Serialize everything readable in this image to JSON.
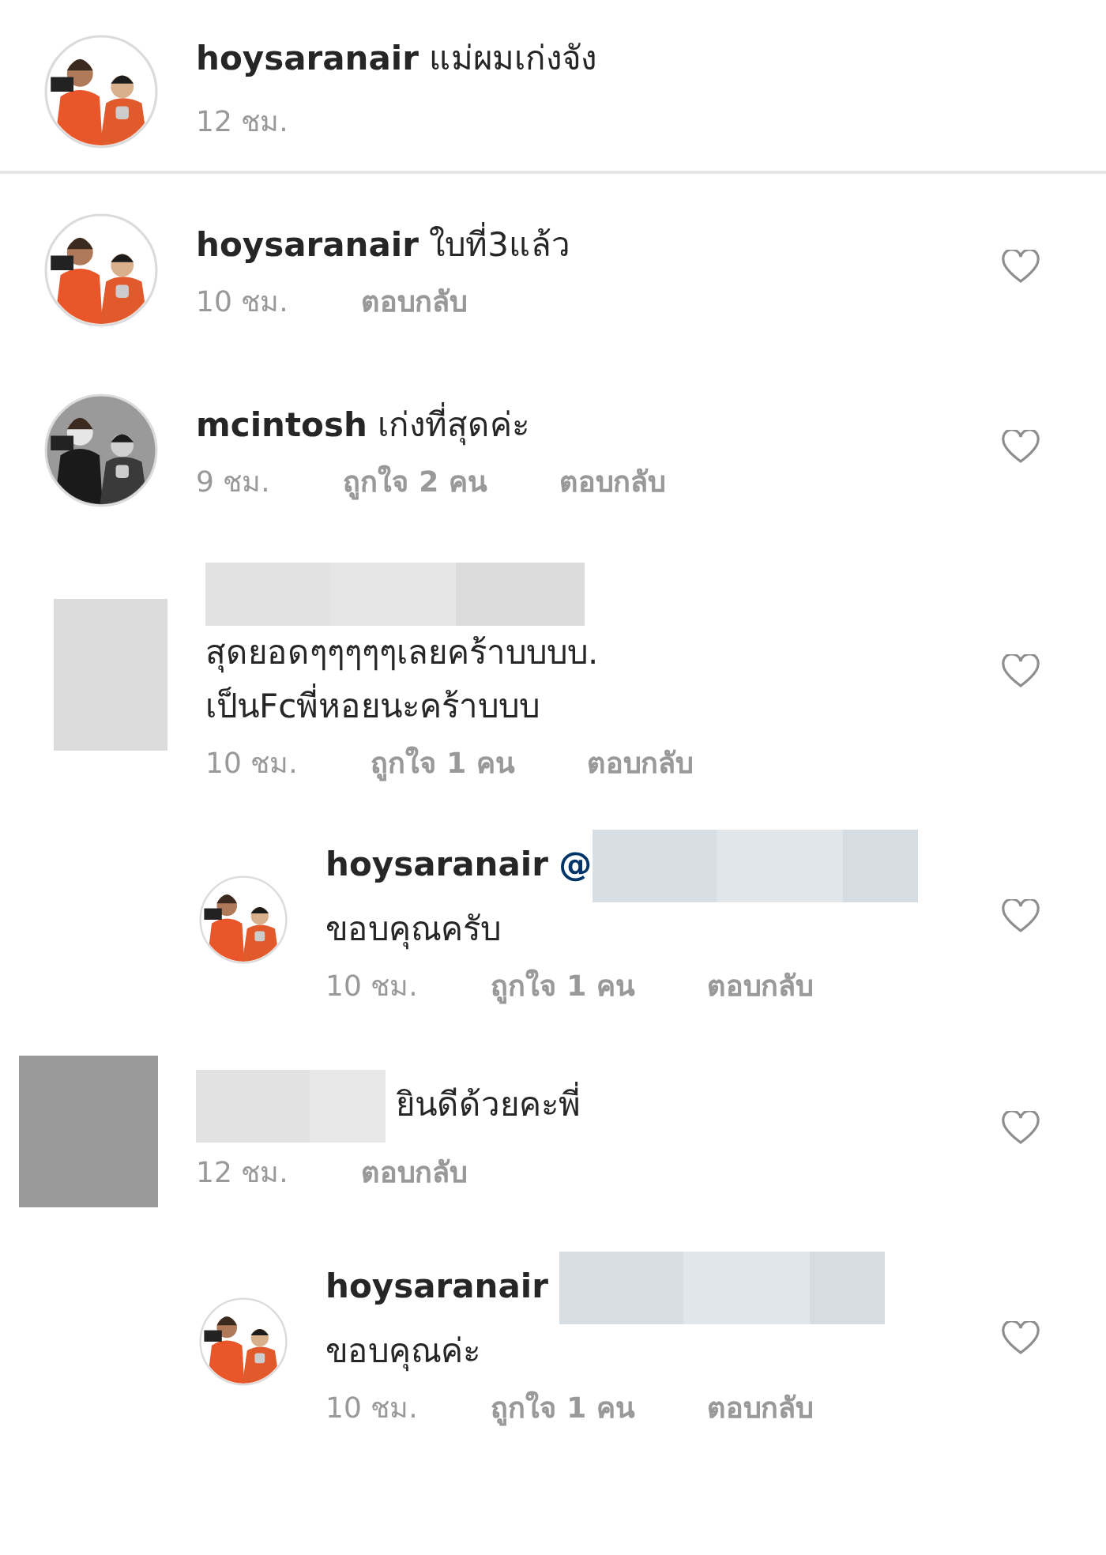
{
  "caption": {
    "username": "hoysaranair",
    "text": "แม่ผมเก่งจัง",
    "avatar": {
      "kind": "picture",
      "grayscale": false
    },
    "time": "12 ชม."
  },
  "comments": [
    {
      "kind": "comment",
      "avatar": {
        "kind": "picture",
        "grayscale": false
      },
      "username": "hoysaranair",
      "line_break": false,
      "lines": [
        "ใบที่3แล้ว"
      ],
      "time": "10 ชม.",
      "reply": "ตอบกลับ",
      "liked": false
    },
    {
      "kind": "comment",
      "avatar": {
        "kind": "picture",
        "grayscale": true
      },
      "username": "mcintosh",
      "line_break": false,
      "lines": [
        "เก่งที่สุดค่ะ"
      ],
      "time": "9 ชม.",
      "likes": "ถูกใจ 2 คน",
      "reply": "ตอบกลับ",
      "liked": false
    },
    {
      "kind": "comment",
      "avatar": {
        "kind": "redacted"
      },
      "name_redacted": true,
      "line_break": true,
      "lines": [
        "สุดยอดๆๆๆๆๆเลยคร้าบบบบ.",
        "เป็นFcพี่หอยนะคร้าบบบ"
      ],
      "time": "10 ชม.",
      "likes": "ถูกใจ 1 คน",
      "reply": "ตอบกลับ",
      "liked": false
    },
    {
      "kind": "reply",
      "avatar": {
        "kind": "picture",
        "grayscale": false
      },
      "username": "hoysaranair",
      "mention": "@",
      "mention_redacted": true,
      "line_break": true,
      "lines": [
        "ขอบคุณครับ"
      ],
      "time": "10 ชม.",
      "likes": "ถูกใจ 1 คน",
      "reply": "ตอบกลับ",
      "liked": false
    },
    {
      "kind": "comment",
      "avatar": {
        "kind": "redacted"
      },
      "name_redacted": true,
      "line_break": false,
      "lines": [
        "ยินดีด้วยคะพี่"
      ],
      "time": "12 ชม.",
      "reply": "ตอบกลับ",
      "liked": false
    },
    {
      "kind": "reply",
      "avatar": {
        "kind": "picture",
        "grayscale": false
      },
      "username": "hoysaranair",
      "mention_redacted": true,
      "line_break": false,
      "lines": [
        "ขอบคุณค่ะ"
      ],
      "time": "10 ชม.",
      "likes": "ถูกใจ 1 คน",
      "reply": "ตอบกลับ",
      "liked": false
    }
  ]
}
